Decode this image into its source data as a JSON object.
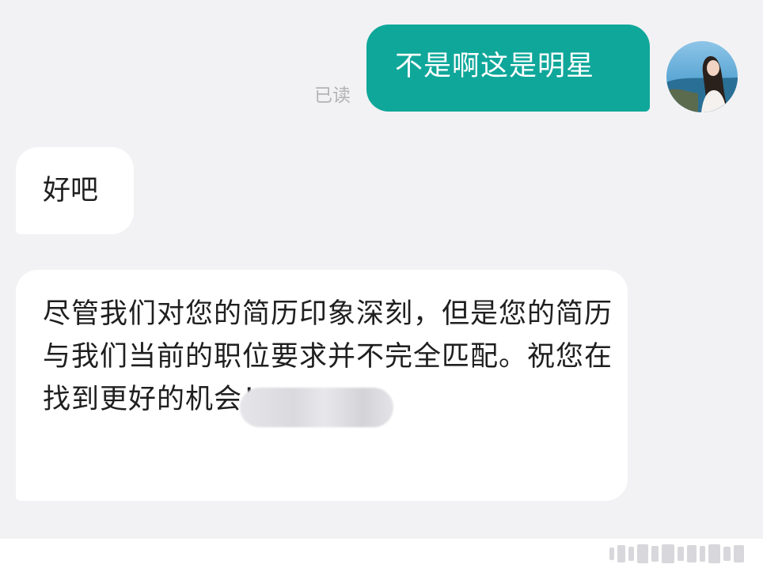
{
  "messages": {
    "outgoing_1": {
      "text": "不是啊这是明星",
      "status": "已读"
    },
    "incoming_1": {
      "text": "好吧"
    },
    "incoming_2": {
      "text": "尽管我们对您的简历印象深刻，但是您的简历与我们当前的职位要求并不完全匹配。祝您在　　　　　找到更好的机会！"
    }
  },
  "colors": {
    "outgoing_bubble": "#0fa79a",
    "incoming_bubble": "#ffffff",
    "background": "#f2f2f4",
    "read_status": "#b3b3b3"
  },
  "icons": {
    "avatar": "user-avatar-photo"
  }
}
